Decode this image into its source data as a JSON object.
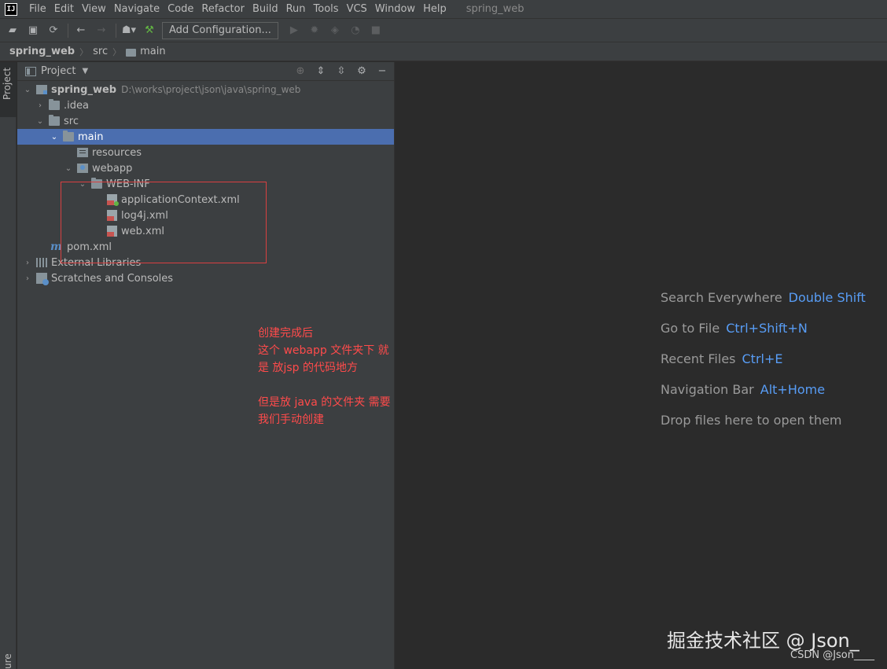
{
  "app": {
    "logo_text": "IJ",
    "window_title": "spring_web"
  },
  "menu": [
    "File",
    "Edit",
    "View",
    "Navigate",
    "Code",
    "Refactor",
    "Build",
    "Run",
    "Tools",
    "VCS",
    "Window",
    "Help"
  ],
  "toolbar": {
    "config_label": "Add Configuration..."
  },
  "breadcrumb": {
    "project": "spring_web",
    "folder1": "src",
    "folder2": "main"
  },
  "tool_strip": {
    "project_tab": "Project",
    "bottom_tab": "ure"
  },
  "project_panel": {
    "title": "Project",
    "tree": {
      "root_name": "spring_web",
      "root_path": "D:\\works\\project\\json\\java\\spring_web",
      "idea": ".idea",
      "src": "src",
      "main": "main",
      "resources": "resources",
      "webapp": "webapp",
      "webinf": "WEB-INF",
      "app_context": "applicationContext.xml",
      "log4j": "log4j.xml",
      "web_xml": "web.xml",
      "pom": "pom.xml",
      "ext_libs": "External Libraries",
      "scratches": "Scratches and Consoles"
    }
  },
  "annotation": {
    "line1": "创建完成后",
    "line2": "这个 webapp 文件夹下 就是 放jsp 的代码地方",
    "line3": "但是放 java 的文件夹  需要 我们手动创建"
  },
  "editor_hints": [
    {
      "label": "Search Everywhere",
      "key": "Double Shift"
    },
    {
      "label": "Go to File",
      "key": "Ctrl+Shift+N"
    },
    {
      "label": "Recent Files",
      "key": "Ctrl+E"
    },
    {
      "label": "Navigation Bar",
      "key": "Alt+Home"
    },
    {
      "label": "Drop files here to open them",
      "key": ""
    }
  ],
  "watermark": {
    "main": "掘金技术社区 @ Json_",
    "sub": "CSDN @Json____"
  },
  "colors": {
    "selection": "#4b6eaf",
    "annotation": "#ff4b4b",
    "shortcut": "#589df6"
  }
}
